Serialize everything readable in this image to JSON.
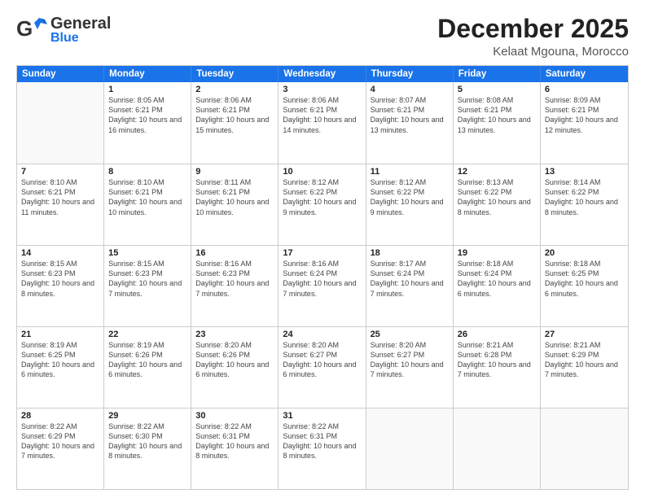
{
  "logo": {
    "general": "General",
    "blue": "Blue"
  },
  "title": "December 2025",
  "subtitle": "Kelaat Mgouna, Morocco",
  "weekdays": [
    "Sunday",
    "Monday",
    "Tuesday",
    "Wednesday",
    "Thursday",
    "Friday",
    "Saturday"
  ],
  "weeks": [
    [
      {
        "day": "",
        "empty": true
      },
      {
        "day": "1",
        "sunrise": "Sunrise: 8:05 AM",
        "sunset": "Sunset: 6:21 PM",
        "daylight": "Daylight: 10 hours and 16 minutes."
      },
      {
        "day": "2",
        "sunrise": "Sunrise: 8:06 AM",
        "sunset": "Sunset: 6:21 PM",
        "daylight": "Daylight: 10 hours and 15 minutes."
      },
      {
        "day": "3",
        "sunrise": "Sunrise: 8:06 AM",
        "sunset": "Sunset: 6:21 PM",
        "daylight": "Daylight: 10 hours and 14 minutes."
      },
      {
        "day": "4",
        "sunrise": "Sunrise: 8:07 AM",
        "sunset": "Sunset: 6:21 PM",
        "daylight": "Daylight: 10 hours and 13 minutes."
      },
      {
        "day": "5",
        "sunrise": "Sunrise: 8:08 AM",
        "sunset": "Sunset: 6:21 PM",
        "daylight": "Daylight: 10 hours and 13 minutes."
      },
      {
        "day": "6",
        "sunrise": "Sunrise: 8:09 AM",
        "sunset": "Sunset: 6:21 PM",
        "daylight": "Daylight: 10 hours and 12 minutes."
      }
    ],
    [
      {
        "day": "7",
        "sunrise": "Sunrise: 8:10 AM",
        "sunset": "Sunset: 6:21 PM",
        "daylight": "Daylight: 10 hours and 11 minutes."
      },
      {
        "day": "8",
        "sunrise": "Sunrise: 8:10 AM",
        "sunset": "Sunset: 6:21 PM",
        "daylight": "Daylight: 10 hours and 10 minutes."
      },
      {
        "day": "9",
        "sunrise": "Sunrise: 8:11 AM",
        "sunset": "Sunset: 6:21 PM",
        "daylight": "Daylight: 10 hours and 10 minutes."
      },
      {
        "day": "10",
        "sunrise": "Sunrise: 8:12 AM",
        "sunset": "Sunset: 6:22 PM",
        "daylight": "Daylight: 10 hours and 9 minutes."
      },
      {
        "day": "11",
        "sunrise": "Sunrise: 8:12 AM",
        "sunset": "Sunset: 6:22 PM",
        "daylight": "Daylight: 10 hours and 9 minutes."
      },
      {
        "day": "12",
        "sunrise": "Sunrise: 8:13 AM",
        "sunset": "Sunset: 6:22 PM",
        "daylight": "Daylight: 10 hours and 8 minutes."
      },
      {
        "day": "13",
        "sunrise": "Sunrise: 8:14 AM",
        "sunset": "Sunset: 6:22 PM",
        "daylight": "Daylight: 10 hours and 8 minutes."
      }
    ],
    [
      {
        "day": "14",
        "sunrise": "Sunrise: 8:15 AM",
        "sunset": "Sunset: 6:23 PM",
        "daylight": "Daylight: 10 hours and 8 minutes."
      },
      {
        "day": "15",
        "sunrise": "Sunrise: 8:15 AM",
        "sunset": "Sunset: 6:23 PM",
        "daylight": "Daylight: 10 hours and 7 minutes."
      },
      {
        "day": "16",
        "sunrise": "Sunrise: 8:16 AM",
        "sunset": "Sunset: 6:23 PM",
        "daylight": "Daylight: 10 hours and 7 minutes."
      },
      {
        "day": "17",
        "sunrise": "Sunrise: 8:16 AM",
        "sunset": "Sunset: 6:24 PM",
        "daylight": "Daylight: 10 hours and 7 minutes."
      },
      {
        "day": "18",
        "sunrise": "Sunrise: 8:17 AM",
        "sunset": "Sunset: 6:24 PM",
        "daylight": "Daylight: 10 hours and 7 minutes."
      },
      {
        "day": "19",
        "sunrise": "Sunrise: 8:18 AM",
        "sunset": "Sunset: 6:24 PM",
        "daylight": "Daylight: 10 hours and 6 minutes."
      },
      {
        "day": "20",
        "sunrise": "Sunrise: 8:18 AM",
        "sunset": "Sunset: 6:25 PM",
        "daylight": "Daylight: 10 hours and 6 minutes."
      }
    ],
    [
      {
        "day": "21",
        "sunrise": "Sunrise: 8:19 AM",
        "sunset": "Sunset: 6:25 PM",
        "daylight": "Daylight: 10 hours and 6 minutes."
      },
      {
        "day": "22",
        "sunrise": "Sunrise: 8:19 AM",
        "sunset": "Sunset: 6:26 PM",
        "daylight": "Daylight: 10 hours and 6 minutes."
      },
      {
        "day": "23",
        "sunrise": "Sunrise: 8:20 AM",
        "sunset": "Sunset: 6:26 PM",
        "daylight": "Daylight: 10 hours and 6 minutes."
      },
      {
        "day": "24",
        "sunrise": "Sunrise: 8:20 AM",
        "sunset": "Sunset: 6:27 PM",
        "daylight": "Daylight: 10 hours and 6 minutes."
      },
      {
        "day": "25",
        "sunrise": "Sunrise: 8:20 AM",
        "sunset": "Sunset: 6:27 PM",
        "daylight": "Daylight: 10 hours and 7 minutes."
      },
      {
        "day": "26",
        "sunrise": "Sunrise: 8:21 AM",
        "sunset": "Sunset: 6:28 PM",
        "daylight": "Daylight: 10 hours and 7 minutes."
      },
      {
        "day": "27",
        "sunrise": "Sunrise: 8:21 AM",
        "sunset": "Sunset: 6:29 PM",
        "daylight": "Daylight: 10 hours and 7 minutes."
      }
    ],
    [
      {
        "day": "28",
        "sunrise": "Sunrise: 8:22 AM",
        "sunset": "Sunset: 6:29 PM",
        "daylight": "Daylight: 10 hours and 7 minutes."
      },
      {
        "day": "29",
        "sunrise": "Sunrise: 8:22 AM",
        "sunset": "Sunset: 6:30 PM",
        "daylight": "Daylight: 10 hours and 8 minutes."
      },
      {
        "day": "30",
        "sunrise": "Sunrise: 8:22 AM",
        "sunset": "Sunset: 6:31 PM",
        "daylight": "Daylight: 10 hours and 8 minutes."
      },
      {
        "day": "31",
        "sunrise": "Sunrise: 8:22 AM",
        "sunset": "Sunset: 6:31 PM",
        "daylight": "Daylight: 10 hours and 8 minutes."
      },
      {
        "day": "",
        "empty": true
      },
      {
        "day": "",
        "empty": true
      },
      {
        "day": "",
        "empty": true
      }
    ]
  ]
}
